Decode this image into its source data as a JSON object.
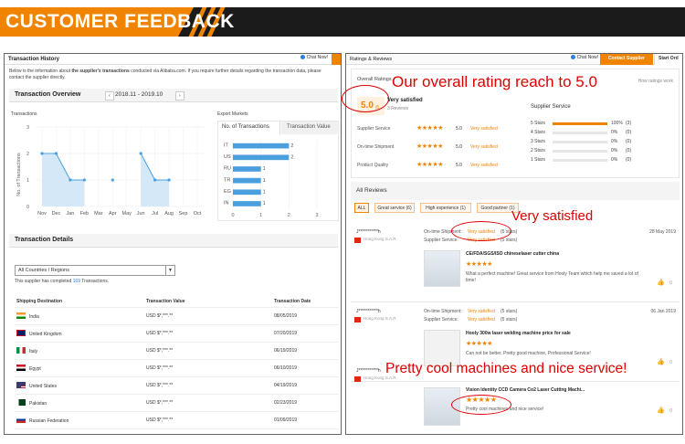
{
  "banner": {
    "title": "CUSTOMER FEEDBACK"
  },
  "left": {
    "header": "Transaction History",
    "chat": "Chat Now!",
    "intro_pre": "Below is the information about ",
    "intro_bold": "the supplier's transactions",
    "intro_post": " conducted via Alibaba.com. If you require further details regarding the transaction data, please contact the supplier directly.",
    "overview": {
      "title": "Transaction Overview",
      "range": "2018.11 - 2019.10",
      "prev": "‹",
      "next": "›"
    },
    "transactions_label": "Transactions",
    "y_axis_label": "No. of Transactions",
    "export_label": "Export Markets",
    "tab_count": "No. of Transactions",
    "tab_value": "Transaction Value",
    "details": {
      "title": "Transaction Details",
      "filter": "All Countries / Regions",
      "completed_pre": "This supplier has completed ",
      "completed_num": "169",
      "completed_post": " Transactions."
    },
    "table": {
      "headers": [
        "Shipping Destination",
        "Transaction Value",
        "Transaction Date"
      ],
      "rows": [
        {
          "country": "India",
          "value": "USD $*,***.**",
          "date": "08/05/2019"
        },
        {
          "country": "United Kingdom",
          "value": "USD $*,***.**",
          "date": "07/20/2019"
        },
        {
          "country": "Italy",
          "value": "USD $*,***.**",
          "date": "06/19/2019"
        },
        {
          "country": "Egypt",
          "value": "USD $*,***.**",
          "date": "06/10/2019"
        },
        {
          "country": "United States",
          "value": "USD $*,***.**",
          "date": "04/19/2019"
        },
        {
          "country": "Pakistan",
          "value": "USD $*,***.**",
          "date": "02/23/2019"
        },
        {
          "country": "Russian Federation",
          "value": "USD $*,***.**",
          "date": "01/09/2019"
        }
      ]
    }
  },
  "chart_data": [
    {
      "type": "area",
      "title": "Transactions",
      "ylabel": "No. of Transactions",
      "categories": [
        "Nov",
        "Dec",
        "Jan",
        "Feb",
        "Mar",
        "Apr",
        "May",
        "Jun",
        "Jul",
        "Aug",
        "Sep",
        "Oct"
      ],
      "values": [
        2,
        2,
        1,
        1,
        null,
        1,
        null,
        2,
        1,
        1,
        null,
        null
      ],
      "yticks": [
        0,
        1,
        2,
        3
      ],
      "ylim": [
        0,
        3
      ],
      "color": "#4a9fde"
    },
    {
      "type": "bar",
      "title": "Export Markets",
      "categories": [
        "IT",
        "US",
        "RU",
        "TR",
        "EG",
        "IN"
      ],
      "values": [
        2,
        2,
        1,
        1,
        1,
        1
      ],
      "xticks": [
        0,
        1,
        2,
        3
      ],
      "xlim": [
        0,
        3
      ],
      "color": "#4a9fde"
    }
  ],
  "right": {
    "header": "Ratings & Reviews",
    "chat": "Chat Now!",
    "contact": "Contact Supplier",
    "start_order": "Start Ord",
    "overall_label": "Overall Ratings",
    "score": "5.0",
    "score_suffix": "/5",
    "score_text": "Very satisfied",
    "review_count": "3 Reviews",
    "how_ratings": "How ratings work",
    "supplier_service_title": "Supplier Service",
    "ratings": [
      {
        "label": "Supplier Service",
        "stars": "★★★★★",
        "score": "5.0",
        "text": "Very satisfied"
      },
      {
        "label": "On-time Shipment",
        "stars": "★★★★★",
        "score": "5.0",
        "text": "Very satisfied"
      },
      {
        "label": "Product Quality",
        "stars": "★★★★★",
        "score": "5.0",
        "text": "Very satisfied"
      }
    ],
    "distribution": [
      {
        "label": "5 Stars",
        "pct": "100%",
        "count": "(3)",
        "fill": 1.0
      },
      {
        "label": "4 Stars",
        "pct": "0%",
        "count": "(0)",
        "fill": 0
      },
      {
        "label": "3 Stars",
        "pct": "0%",
        "count": "(0)",
        "fill": 0
      },
      {
        "label": "2 Stars",
        "pct": "0%",
        "count": "(0)",
        "fill": 0
      },
      {
        "label": "1 Stars",
        "pct": "0%",
        "count": "(0)",
        "fill": 0
      }
    ],
    "all_reviews": "All Reviews",
    "filters": [
      "ALL",
      "Great service (6)",
      "High experience (1)",
      "Good partner (1)"
    ],
    "reviews": [
      {
        "user": "J***********h",
        "company": "Hong Kong S.A.R.",
        "ship_label": "On-time Shipment:",
        "ship_val": "Very satisfied",
        "ship_stars": "(5 stars)",
        "svc_label": "Supplier Service:",
        "svc_val": "Very satisfied",
        "svc_stars": "(5 stars)",
        "date": "28 May 2019",
        "product": "CE/FDA/SGS/ISO chineselaser cutter china",
        "stars": "★★★★★",
        "comment": "What a perfect machine! Great service from Hooly Team which help me saved a lot of time!",
        "likes": "0"
      },
      {
        "user": "J***********h",
        "company": "Hong Kong S.A.R.",
        "ship_label": "On-time Shipment:",
        "ship_val": "Very satisfied",
        "ship_stars": "(5 stars)",
        "svc_label": "Supplier Service:",
        "svc_val": "Very satisfied",
        "svc_stars": "(5 stars)",
        "date": "06 Jan 2019",
        "product": "Hooly 300w laser welding machine price for sale",
        "stars": "★★★★★",
        "comment": "Can not be better. Pretty good machine, Professional Service!",
        "likes": "0"
      },
      {
        "user": "J***********h",
        "company": "Hong Kong S.A.R.",
        "ship_label": "",
        "ship_val": "",
        "ship_stars": "",
        "svc_label": "",
        "svc_val": "",
        "svc_stars": "",
        "date": "",
        "product": "Vision Identity CCD Camera Co2 Laser Cutting Machi...",
        "stars": "★★★★★",
        "comment": "Pretty cool machines and nice service!",
        "likes": "0"
      }
    ]
  },
  "annotations": {
    "overall": "Our overall rating reach to 5.0",
    "satisfied": "Very satisfied",
    "cool": "Pretty cool machines and nice service!"
  },
  "colors": {
    "accent": "#f08300",
    "bar": "#4a9fde",
    "annotation": "#dd0000"
  }
}
